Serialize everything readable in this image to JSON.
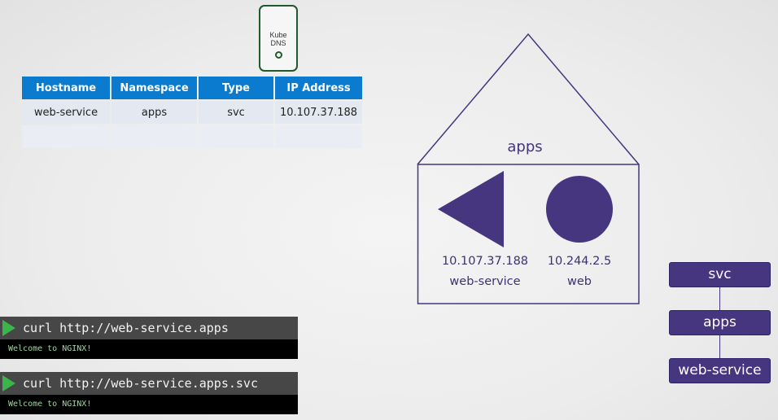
{
  "dns_server": {
    "label_line1": "Kube",
    "label_line2": "DNS"
  },
  "dns_table": {
    "headers": [
      "Hostname",
      "Namespace",
      "Type",
      "IP Address"
    ],
    "rows": [
      [
        "web-service",
        "apps",
        "svc",
        "10.107.37.188"
      ],
      [
        "",
        "",
        "",
        ""
      ]
    ]
  },
  "namespace": {
    "name": "apps",
    "service": {
      "ip": "10.107.37.188",
      "name": "web-service"
    },
    "pod": {
      "ip": "10.244.2.5",
      "name": "web"
    }
  },
  "terminals": [
    {
      "command": "curl http://web-service.apps",
      "output": "Welcome to NGINX!"
    },
    {
      "command": "curl http://web-service.apps.svc",
      "output": "Welcome to NGINX!"
    }
  ],
  "hierarchy": [
    "svc",
    "apps",
    "web-service"
  ],
  "colors": {
    "accent": "#46357f",
    "table_header": "#0b7bd0",
    "dns_border": "#1f5a2a",
    "prompt": "#39b54a"
  }
}
